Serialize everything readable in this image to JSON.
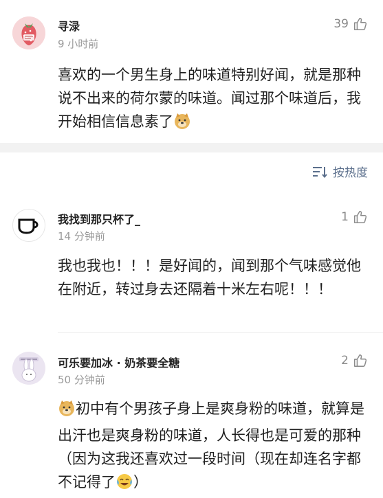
{
  "comments": [
    {
      "username": "寻渌",
      "time": "9 小时前",
      "likes": "39",
      "text": "喜欢的一个男生身上的味道特别好闻，就是那种说不出来的荷尔蒙的味道。闻过那个味道后，我开始相信信息素了"
    },
    {
      "username": "我找到那只杯了_",
      "time": "14 分钟前",
      "likes": "1",
      "text": "我也我也！！！是好闻的，闻到那个气味感觉他在附近，转过身去还隔着十米左右呢！！！"
    },
    {
      "username": "可乐要加冰 · 奶茶要全糖",
      "time": "50 分钟前",
      "likes": "2",
      "text_a": "初中有个男孩子身上是爽身粉的味道，就算是出汗也是爽身粉的味道，人长得也是可爱的那种（因为这我还喜欢过一段时间（现在却连名字都不记得了",
      "text_b": "）"
    }
  ],
  "sort_label": "按热度",
  "icons": {
    "like": "thumbs-up-icon",
    "sort": "sort-icon",
    "doge": "doge-emoji-icon",
    "cry_laugh": "laugh-cry-emoji-icon"
  },
  "colors": {
    "accent": "#5b6f8c",
    "muted": "#9a9a9a",
    "band": "#f2f2f2"
  }
}
